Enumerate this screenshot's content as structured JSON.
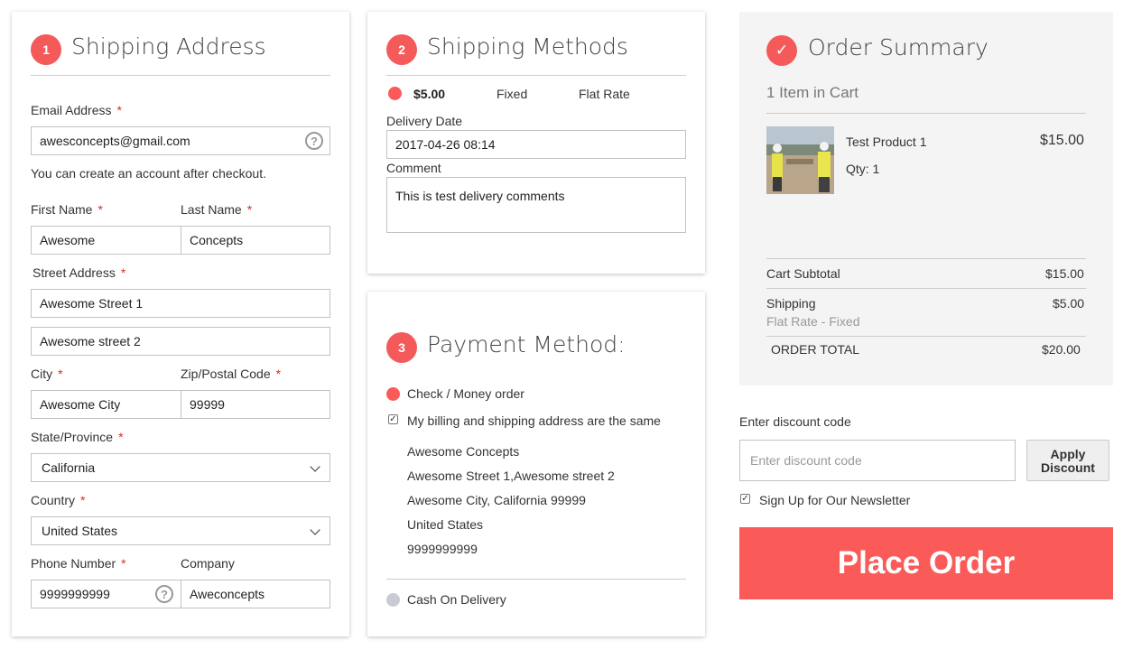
{
  "shipping_address": {
    "step": "1",
    "title": "Shipping Address",
    "email_label": "Email Address",
    "email_value": "awesconcepts@gmail.com",
    "email_note": "You can create an account after checkout.",
    "first_name_label": "First Name",
    "first_name_value": "Awesome",
    "last_name_label": "Last Name",
    "last_name_value": "Concepts",
    "street_label": "Street Address",
    "street1_value": "Awesome Street 1",
    "street2_value": "Awesome street 2",
    "city_label": "City",
    "city_value": "Awesome City",
    "zip_label": "Zip/Postal Code",
    "zip_value": "99999",
    "state_label": "State/Province",
    "state_value": "California",
    "country_label": "Country",
    "country_value": "United States",
    "phone_label": "Phone Number",
    "phone_value": "9999999999",
    "company_label": "Company",
    "company_value": "Aweconcepts",
    "required_mark": "*",
    "help_glyph": "?"
  },
  "shipping_methods": {
    "step": "2",
    "title": "Shipping Methods",
    "price": "$5.00",
    "method": "Fixed",
    "carrier": "Flat Rate",
    "delivery_date_label": "Delivery Date",
    "delivery_date_value": "2017-04-26 08:14",
    "comment_label": "Comment",
    "comment_value": "This is test delivery comments"
  },
  "payment_method": {
    "step": "3",
    "title": "Payment Method:",
    "option_check": "Check / Money order",
    "same_address_label": "My billing and shipping address are the same",
    "address_lines": [
      "Awesome Concepts",
      "Awesome Street 1,Awesome street 2",
      "Awesome City, California 99999",
      "United States",
      "9999999999"
    ],
    "option_cod": "Cash On Delivery"
  },
  "order_summary": {
    "check_glyph": "✓",
    "title": "Order Summary",
    "items_in_cart": "1 Item in Cart",
    "product_name": "Test Product 1",
    "product_qty": "Qty: 1",
    "product_price": "$15.00",
    "subtotal_label": "Cart Subtotal",
    "subtotal_value": "$15.00",
    "shipping_label": "Shipping",
    "shipping_method": "Flat Rate - Fixed",
    "shipping_value": "$5.00",
    "total_label": "ORDER TOTAL",
    "total_value": "$20.00"
  },
  "discount": {
    "label": "Enter discount code",
    "placeholder": "Enter discount code",
    "button_line1": "Apply",
    "button_line2": "Discount"
  },
  "newsletter_label": "Sign Up for Our Newsletter",
  "place_order_label": "Place Order",
  "colors": {
    "accent": "#fa5b59",
    "radio_inactive": "#c8ccd2",
    "summary_bg": "#f4f4f4"
  }
}
